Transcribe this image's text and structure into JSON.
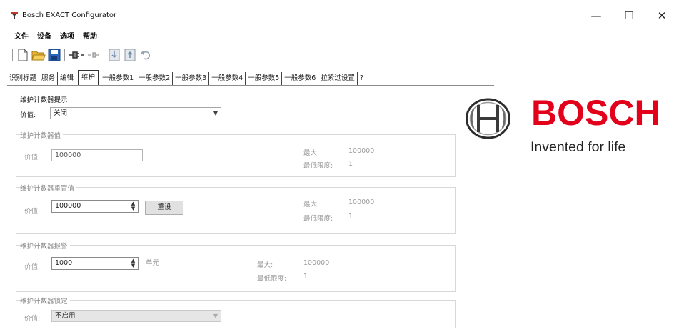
{
  "window": {
    "title": "Bosch EXACT Configurator",
    "controls": {
      "minimize": "—",
      "maximize": "☐",
      "close": "✕"
    }
  },
  "menu": [
    "文件",
    "设备",
    "选项",
    "帮助"
  ],
  "toolbar": {
    "icons": [
      "new-file-icon",
      "open-folder-icon",
      "save-disk-icon",
      "connect-plug-icon",
      "disconnect-icon",
      "read-device-icon",
      "write-device-icon",
      "undo-icon"
    ]
  },
  "tabs": [
    {
      "label": "识别标题"
    },
    {
      "label": "服务"
    },
    {
      "label": "编辑"
    },
    {
      "label": "维护",
      "active": true
    },
    {
      "label": "一般参数1"
    },
    {
      "label": "一般参数2"
    },
    {
      "label": "一般参数3"
    },
    {
      "label": "一般参数4"
    },
    {
      "label": "一般参数5"
    },
    {
      "label": "一般参数6"
    },
    {
      "label": "拉紧过设置"
    },
    {
      "label": "?"
    }
  ],
  "maintenance_display": {
    "title": "维护计数器提示",
    "value_label": "价值:",
    "value": "关闭"
  },
  "counter_value": {
    "title": "维护计数器值",
    "value_label": "价值:",
    "value": "100000",
    "max_label": "最大:",
    "max_value": "100000",
    "min_label": "最低限度:",
    "min_value": "1"
  },
  "counter_reset": {
    "title": "维护计数器重置值",
    "value_label": "价值:",
    "value": "100000",
    "reset_button": "重设",
    "max_label": "最大:",
    "max_value": "100000",
    "min_label": "最低限度:",
    "min_value": "1"
  },
  "counter_warning": {
    "title": "维护计数器报警",
    "value_label": "价值:",
    "value": "1000",
    "unit": "单元",
    "max_label": "最大:",
    "max_value": "100000",
    "min_label": "最低限度:",
    "min_value": "1"
  },
  "counter_lock": {
    "title": "维护计数器锁定",
    "value_label": "价值:",
    "value": "不启用"
  },
  "brand": {
    "wordmark": "BOSCH",
    "tagline": "Invented for life",
    "color": "#e2001a"
  }
}
